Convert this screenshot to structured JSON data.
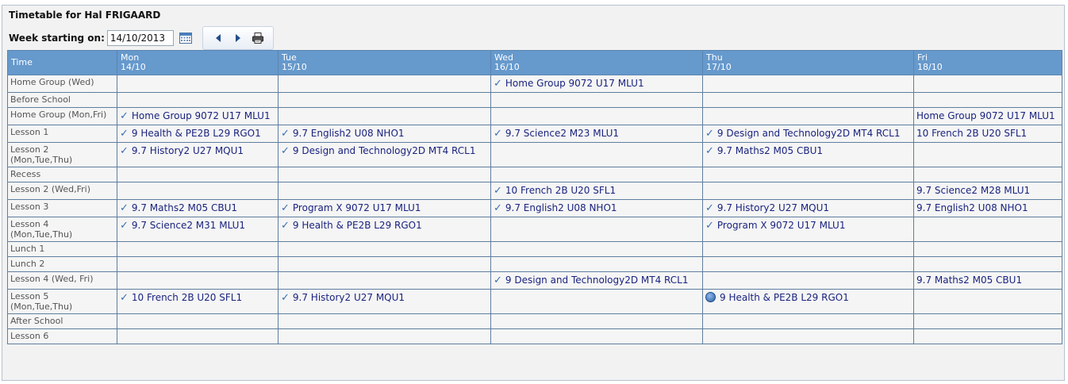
{
  "title": "Timetable for Hal FRIGAARD",
  "week": {
    "label": "Week starting on:",
    "value": "14/10/2013"
  },
  "header": {
    "time": "Time",
    "days": [
      {
        "day": "Mon",
        "date": "14/10"
      },
      {
        "day": "Tue",
        "date": "15/10"
      },
      {
        "day": "Wed",
        "date": "16/10"
      },
      {
        "day": "Thu",
        "date": "17/10"
      },
      {
        "day": "Fri",
        "date": "18/10"
      }
    ]
  },
  "rows": [
    {
      "time": "Home Group (Wed)",
      "sub": "",
      "cells": [
        "",
        "",
        "Home Group 9072 U17 MLU1",
        "",
        ""
      ]
    },
    {
      "time": "Before School",
      "sub": "",
      "cells": [
        "",
        "",
        "",
        "",
        ""
      ]
    },
    {
      "time": "Home Group (Mon,Fri)",
      "sub": "",
      "cells": [
        "Home Group 9072 U17 MLU1",
        "",
        "",
        "",
        "Home Group 9072 U17 MLU1"
      ]
    },
    {
      "time": "Lesson 1",
      "sub": "",
      "cells": [
        "9 Health & PE2B L29 RGO1",
        "9.7 English2 U08 NHO1",
        "9.7 Science2 M23 MLU1",
        "9 Design and Technology2D MT4 RCL1",
        "10 French 2B U20 SFL1"
      ]
    },
    {
      "time": "Lesson 2",
      "sub": "(Mon,Tue,Thu)",
      "cells": [
        "9.7 History2 U27 MQU1",
        "9 Design and Technology2D MT4 RCL1",
        "",
        "9.7 Maths2 M05 CBU1",
        ""
      ]
    },
    {
      "time": "Recess",
      "sub": "",
      "cells": [
        "",
        "",
        "",
        "",
        ""
      ]
    },
    {
      "time": "Lesson 2 (Wed,Fri)",
      "sub": "",
      "cells": [
        "",
        "",
        "10 French 2B U20 SFL1",
        "",
        "9.7 Science2 M28 MLU1"
      ]
    },
    {
      "time": "Lesson 3",
      "sub": "",
      "cells": [
        "9.7 Maths2 M05 CBU1",
        "Program X 9072 U17 MLU1",
        "9.7 English2 U08 NHO1",
        "9.7 History2 U27 MQU1",
        "9.7 English2 U08 NHO1"
      ]
    },
    {
      "time": "Lesson 4",
      "sub": "(Mon,Tue,Thu)",
      "cells": [
        "9.7 Science2 M31 MLU1",
        "9 Health & PE2B L29 RGO1",
        "",
        "Program X 9072 U17 MLU1",
        ""
      ]
    },
    {
      "time": "Lunch 1",
      "sub": "",
      "cells": [
        "",
        "",
        "",
        "",
        ""
      ]
    },
    {
      "time": "Lunch 2",
      "sub": "",
      "cells": [
        "",
        "",
        "",
        "",
        ""
      ]
    },
    {
      "time": "Lesson 4 (Wed, Fri)",
      "sub": "",
      "cells": [
        "",
        "",
        "9 Design and Technology2D MT4 RCL1",
        "",
        "9.7 Maths2 M05 CBU1"
      ]
    },
    {
      "time": "Lesson 5",
      "sub": "(Mon,Tue,Thu)",
      "cells": [
        "10 French 2B U20 SFL1",
        "9.7 History2 U27 MQU1",
        "",
        "9 Health & PE2B L29 RGO1",
        ""
      ]
    },
    {
      "time": "After School",
      "sub": "",
      "cells": [
        "",
        "",
        "",
        "",
        ""
      ]
    },
    {
      "time": "Lesson 6",
      "sub": "",
      "cells": [
        "",
        "",
        "",
        "",
        ""
      ]
    }
  ],
  "marks": [
    [
      "",
      "",
      "tick",
      "",
      ""
    ],
    [
      "",
      "",
      "",
      "",
      ""
    ],
    [
      "tick",
      "",
      "",
      "",
      ""
    ],
    [
      "tick",
      "tick",
      "tick",
      "tick",
      ""
    ],
    [
      "tick",
      "tick",
      "",
      "tick",
      ""
    ],
    [
      "",
      "",
      "",
      "",
      ""
    ],
    [
      "",
      "",
      "tick",
      "",
      ""
    ],
    [
      "tick",
      "tick",
      "tick",
      "tick",
      ""
    ],
    [
      "tick",
      "tick",
      "",
      "tick",
      ""
    ],
    [
      "",
      "",
      "",
      "",
      ""
    ],
    [
      "",
      "",
      "",
      "",
      ""
    ],
    [
      "",
      "",
      "tick",
      "",
      ""
    ],
    [
      "tick",
      "tick",
      "",
      "ball",
      ""
    ],
    [
      "",
      "",
      "",
      "",
      ""
    ],
    [
      "",
      "",
      "",
      "",
      ""
    ]
  ],
  "icons": {
    "calendar": "calendar-icon",
    "prev": "arrow-left-icon",
    "next": "arrow-right-icon",
    "print": "printer-icon",
    "tick": "check-icon",
    "ball": "sport-ball-icon"
  }
}
